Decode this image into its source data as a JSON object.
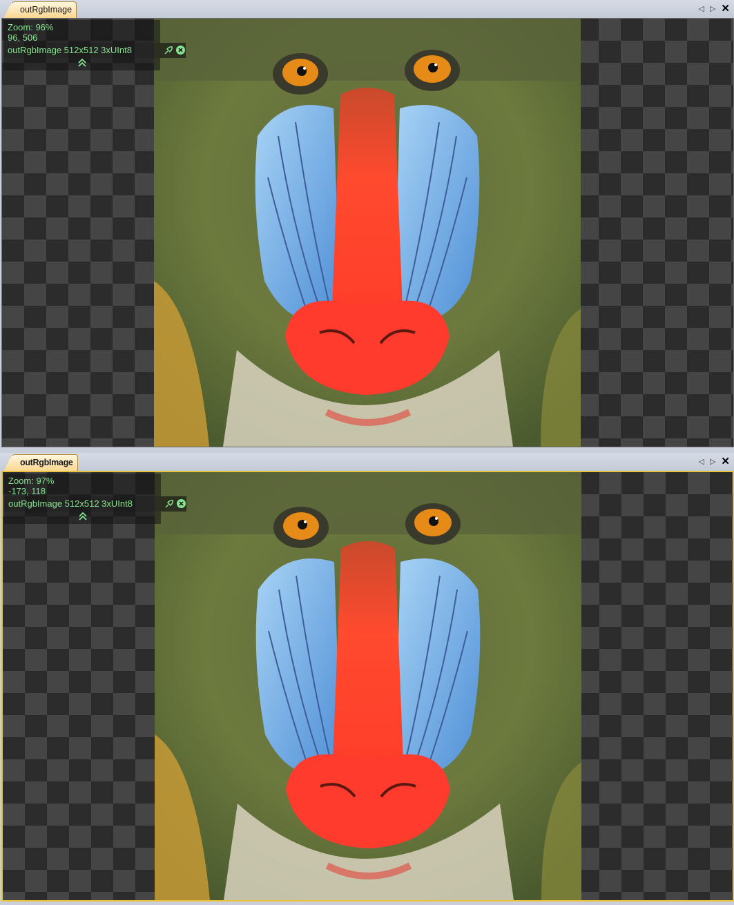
{
  "panels": [
    {
      "tab_label": "outRgbImage",
      "zoom_text": "Zoom: 96%",
      "coord_text": "96, 506",
      "image_info": "outRgbImage 512x512 3xUInt8",
      "active": false
    },
    {
      "tab_label": "outRgbImage",
      "zoom_text": "Zoom: 97%",
      "coord_text": "-173, 118",
      "image_info": "outRgbImage 512x512 3xUInt8",
      "active": true
    }
  ],
  "colors": {
    "overlay_text": "#86e58f",
    "active_border": "#e8c23a",
    "tab_fill": "#fbd58e"
  },
  "icons": [
    "nav-left-icon",
    "nav-right-icon",
    "close-icon",
    "pin-icon",
    "remove-icon",
    "collapse-up-icon"
  ]
}
